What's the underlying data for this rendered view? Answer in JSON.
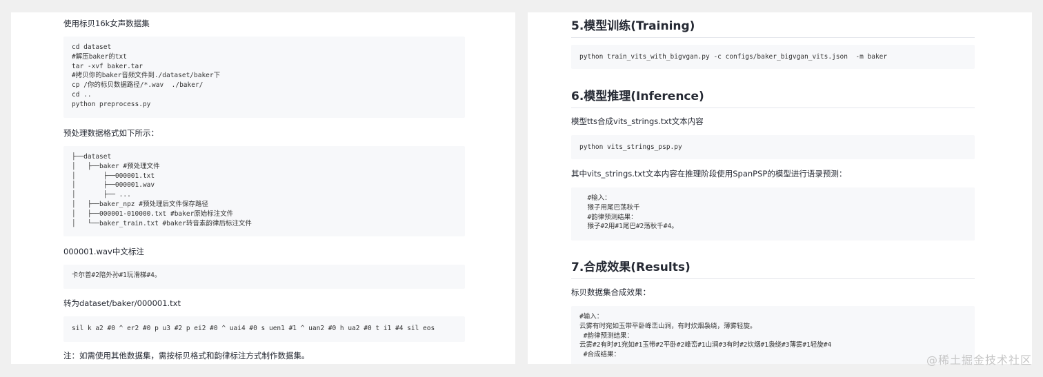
{
  "left": {
    "intro": "使用标贝16k女声数据集",
    "code_prepare": "cd dataset\n#解压baker的txt\ntar -xvf baker.tar\n#拷贝你的baker音频文件到./dataset/baker下\ncp /你的标贝数据路径/*.wav  ./baker/\ncd ..\npython preprocess.py",
    "format_intro": "预处理数据格式如下所示：",
    "code_tree": "├──dataset\n│   ├──baker #预处理文件\n│       ├──000001.txt\n│       ├──000001.wav\n│       ├── ...\n│   ├──baker_npz #预处理后文件保存路径\n│   ├──000001-010000.txt #baker原始标注文件\n│   └──baker_train.txt #baker转音素韵律后标注文件",
    "label_intro": "000001.wav中文标注",
    "code_label": "卡尔普#2陪外孙#1玩滑梯#4。",
    "convert_intro": "转为dataset/baker/000001.txt",
    "code_phoneme": "sil k a2 #0 ^ er2 #0 p u3 #2 p ei2 #0 ^ uai4 #0 s uen1 #1 ^ uan2 #0 h ua2 #0 t i1 #4 sil eos",
    "note": "注：如需使用其他数据集，需按标贝格式和韵律标注方式制作数据集。"
  },
  "right": {
    "training_heading": "5.模型训练(Training)",
    "code_train": "python train_vits_with_bigvgan.py -c configs/baker_bigvgan_vits.json  -m baker",
    "inference_heading": "6.模型推理(Inference)",
    "inference_intro": "模型tts合成vits_strings.txt文本内容",
    "code_infer": "python vits_strings_psp.py",
    "prosody_intro": "其中vits_strings.txt文本内容在推理阶段使用SpanPSP的模型进行语录预测：",
    "code_prosody": "  #输入：\n  猴子用尾巴荡秋千\n  #韵律预测结果：\n  猴子#2用#1尾巴#2荡秋千#4。",
    "results_heading": "7.合成效果(Results)",
    "results_intro": "标贝数据集合成效果：",
    "code_results": "#输入：\n云雾有时宛如玉带平卧峰峦山涧，有时炊烟袅绕，薄雾轻旋。\n #韵律预测结果：\n云雾#2有时#1宛如#1玉带#2平卧#2峰峦#1山涧#3有时#2炊烟#1袅绕#3薄雾#1轻旋#4\n #合成结果："
  },
  "watermark": "@稀土掘金技术社区"
}
